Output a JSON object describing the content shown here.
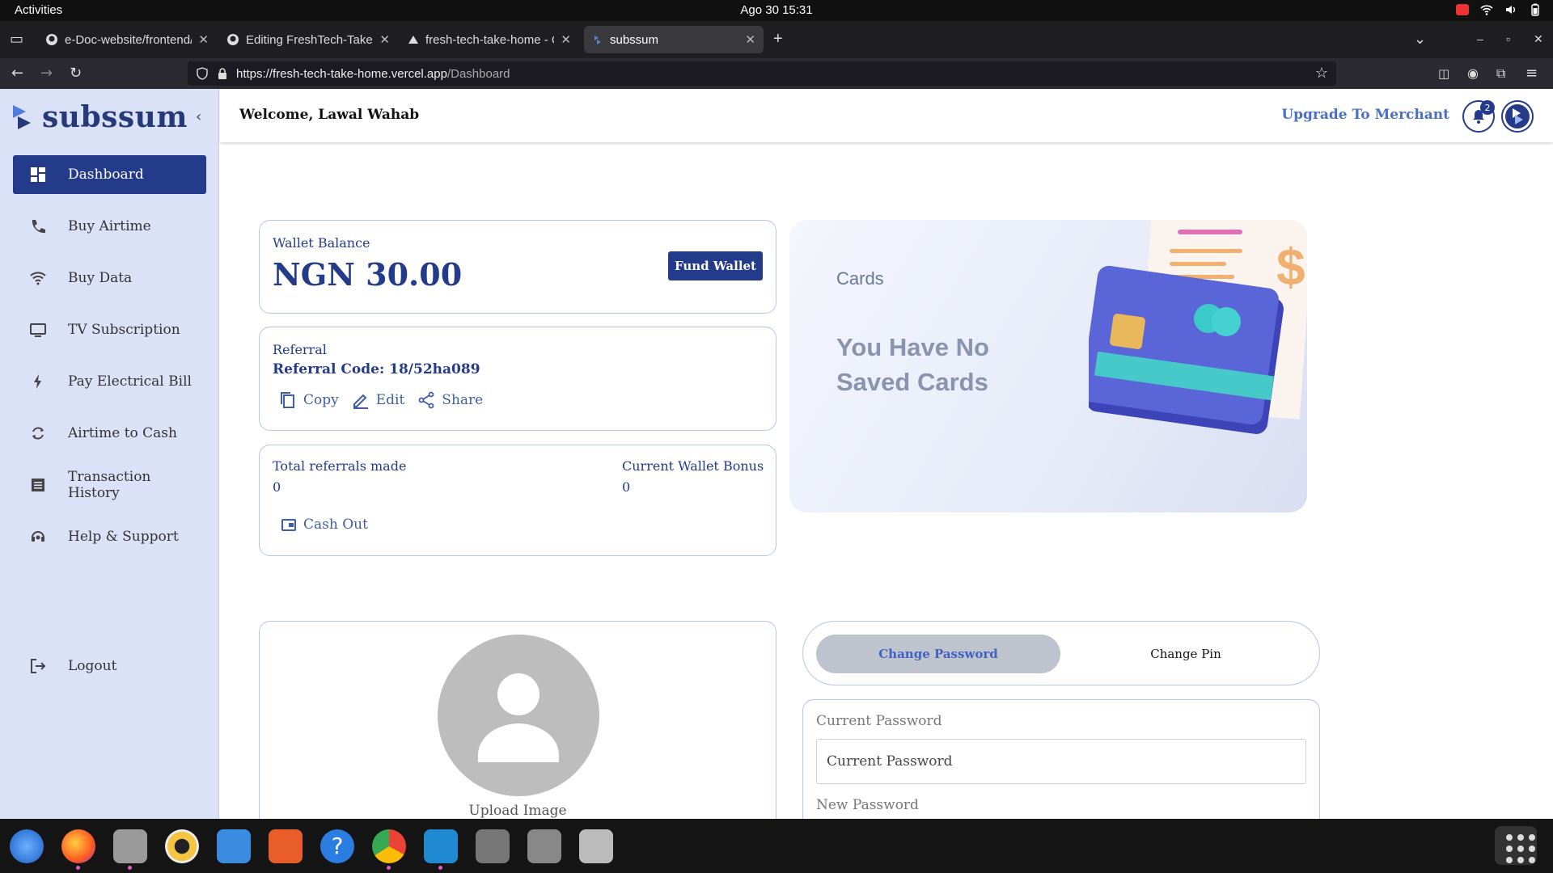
{
  "os": {
    "activities": "Activities",
    "clock": "Ago 30  15:31"
  },
  "browser": {
    "tabs": [
      {
        "label": "e-Doc-website/frontend/",
        "icon": "github-icon"
      },
      {
        "label": "Editing FreshTech-Take-H",
        "icon": "github-icon"
      },
      {
        "label": "fresh-tech-take-home - O",
        "icon": "vercel-icon"
      },
      {
        "label": "subssum",
        "icon": "subssum-icon",
        "active": true
      }
    ],
    "url_host": "https://fresh-tech-take-home.vercel.app",
    "url_path": "/Dashboard"
  },
  "sidebar": {
    "brand": "subssum",
    "items": [
      {
        "label": "Dashboard",
        "icon": "dashboard-icon",
        "active": true
      },
      {
        "label": "Buy Airtime",
        "icon": "phone-icon"
      },
      {
        "label": "Buy Data",
        "icon": "wifi-icon"
      },
      {
        "label": "TV Subscription",
        "icon": "tv-icon"
      },
      {
        "label": "Pay Electrical Bill",
        "icon": "bolt-icon"
      },
      {
        "label": "Airtime to Cash",
        "icon": "refresh-icon"
      },
      {
        "label": "Transaction History",
        "icon": "list-icon"
      },
      {
        "label": "Help & Support",
        "icon": "support-icon"
      }
    ],
    "logout": "Logout"
  },
  "header": {
    "welcome": "Welcome, Lawal Wahab",
    "upgrade": "Upgrade To Merchant",
    "notifications": "2"
  },
  "wallet": {
    "label": "Wallet Balance",
    "balance": "NGN 30.00",
    "fund_button": "Fund Wallet"
  },
  "referral": {
    "label": "Referral",
    "code": "Referral Code: 18/52ha089",
    "copy": "Copy",
    "edit": "Edit",
    "share": "Share"
  },
  "stats": {
    "total_label": "Total referrals made",
    "total_value": "0",
    "bonus_label": "Current Wallet Bonus",
    "bonus_value": "0",
    "cashout": "Cash Out"
  },
  "cards": {
    "title": "Cards",
    "message": "You Have No Saved Cards"
  },
  "profile": {
    "upload": "Upload Image"
  },
  "security": {
    "tab_password": "Change Password",
    "tab_pin": "Change Pin",
    "current_label": "Current Password",
    "current_placeholder": "Current Password",
    "new_label": "New Password"
  },
  "colors": {
    "primary": "#243a8a",
    "sidebar_bg": "#dbe2f7",
    "accent": "#4a6fc6"
  }
}
